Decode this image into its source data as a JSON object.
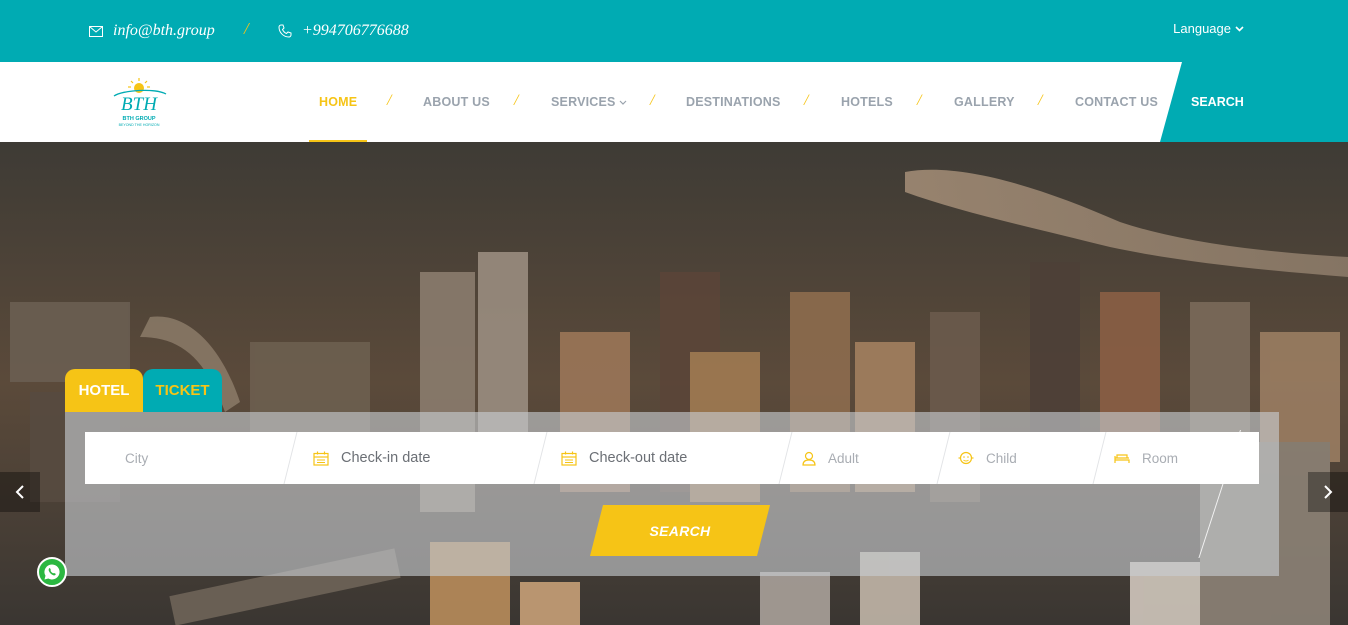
{
  "topbar": {
    "email": "info@bth.group",
    "phone": "+994706776688",
    "separator": "/",
    "language_label": "Language",
    "email_icon": "envelope-icon",
    "phone_icon": "phone-icon"
  },
  "logo": {
    "mark": "BTH",
    "name": "BTH GROUP",
    "tagline": "BEYOND THE HORIZON"
  },
  "nav": {
    "items": [
      {
        "label": "HOME",
        "active": true
      },
      {
        "label": "ABOUT US"
      },
      {
        "label": "SERVICES",
        "has_dropdown": true
      },
      {
        "label": "DESTINATIONS"
      },
      {
        "label": "HOTELS"
      },
      {
        "label": "GALLERY"
      },
      {
        "label": "CONTACT US"
      }
    ],
    "separator": "/",
    "search_label": "SEARCH"
  },
  "booking": {
    "tabs": [
      {
        "label": "HOTEL",
        "active": true
      },
      {
        "label": "TICKET"
      }
    ],
    "fields": {
      "city": "City",
      "checkin": "Check-in date",
      "checkout": "Check-out date",
      "adult": "Adult",
      "child": "Child",
      "room": "Room"
    },
    "search_button": "SEARCH"
  },
  "colors": {
    "teal": "#00abb3",
    "yellow": "#f6c416",
    "nav_gray": "#9aa3ad"
  },
  "icons": [
    "envelope-icon",
    "phone-icon",
    "chevron-down-icon",
    "calendar-icon",
    "user-icon",
    "child-icon",
    "bed-icon",
    "chevron-left-icon",
    "chevron-right-icon",
    "whatsapp-icon"
  ]
}
